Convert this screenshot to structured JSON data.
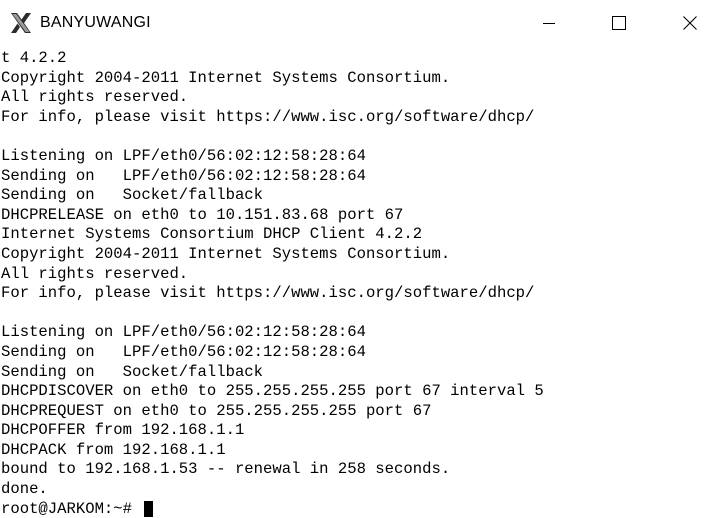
{
  "window": {
    "title": "BANYUWANGI",
    "app_icon": "x-icon"
  },
  "controls": {
    "minimize_icon": "minimize-icon",
    "maximize_icon": "maximize-icon",
    "close_icon": "close-icon"
  },
  "terminal": {
    "lines": [
      "t 4.2.2",
      "Copyright 2004-2011 Internet Systems Consortium.",
      "All rights reserved.",
      "For info, please visit https://www.isc.org/software/dhcp/",
      "",
      "Listening on LPF/eth0/56:02:12:58:28:64",
      "Sending on   LPF/eth0/56:02:12:58:28:64",
      "Sending on   Socket/fallback",
      "DHCPRELEASE on eth0 to 10.151.83.68 port 67",
      "Internet Systems Consortium DHCP Client 4.2.2",
      "Copyright 2004-2011 Internet Systems Consortium.",
      "All rights reserved.",
      "For info, please visit https://www.isc.org/software/dhcp/",
      "",
      "Listening on LPF/eth0/56:02:12:58:28:64",
      "Sending on   LPF/eth0/56:02:12:58:28:64",
      "Sending on   Socket/fallback",
      "DHCPDISCOVER on eth0 to 255.255.255.255 port 67 interval 5",
      "DHCPREQUEST on eth0 to 255.255.255.255 port 67",
      "DHCPOFFER from 192.168.1.1",
      "DHCPACK from 192.168.1.1",
      "bound to 192.168.1.53 -- renewal in 258 seconds.",
      "done."
    ],
    "prompt": "root@JARKOM:~# "
  }
}
